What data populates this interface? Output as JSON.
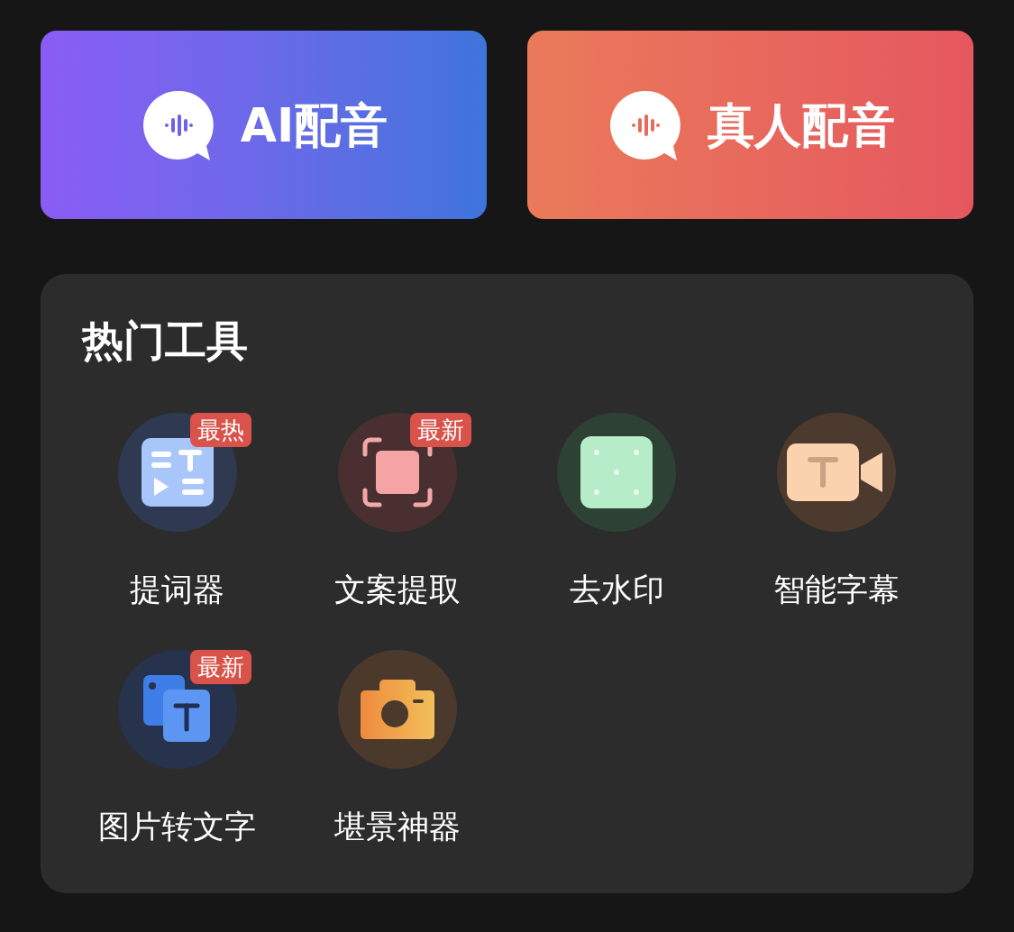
{
  "dubbing_buttons": [
    {
      "kind": "ai",
      "label": "AI配音"
    },
    {
      "kind": "human",
      "label": "真人配音"
    }
  ],
  "hot_tools": {
    "title": "热门工具",
    "tools": [
      {
        "kind": "teleprompter",
        "label": "提词器",
        "badge": "最热"
      },
      {
        "kind": "extract",
        "label": "文案提取",
        "badge": "最新"
      },
      {
        "kind": "watermark",
        "label": "去水印"
      },
      {
        "kind": "subtitle",
        "label": "智能字幕"
      },
      {
        "kind": "image-text",
        "label": "图片转文字",
        "badge": "最新"
      },
      {
        "kind": "camera",
        "label": "堪景神器"
      }
    ]
  }
}
